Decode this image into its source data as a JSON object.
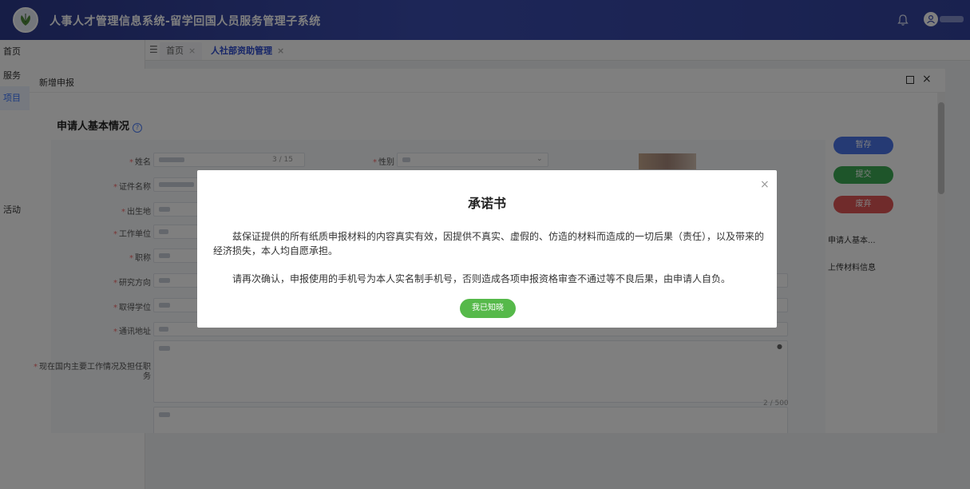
{
  "header": {
    "title": "人事人才管理信息系统-留学回国人员服务管理子系统"
  },
  "sidebar": {
    "items": [
      {
        "label": "首页"
      },
      {
        "label": "服务"
      },
      {
        "label": "项目"
      },
      {
        "label": "活动"
      }
    ]
  },
  "tabs": {
    "items": [
      {
        "label": "首页",
        "close": "×"
      },
      {
        "label": "人社部资助管理",
        "close": "×"
      }
    ]
  },
  "dialog": {
    "title": "新增申报",
    "close": "×",
    "section_title": "申请人基本情况",
    "help_glyph": "?",
    "fields": {
      "name": "姓名",
      "gender": "性别",
      "id_type": "证件名称",
      "birthplace": "出生地",
      "employer": "工作单位",
      "title": "职称",
      "research": "研究方向",
      "degree": "取得学位",
      "address": "通讯地址",
      "current_work": "现在国内主要工作情况及担任职务"
    },
    "name_counter": "3 / 15",
    "textarea_counter": "2 / 500",
    "required_mark": "*",
    "side_buttons": {
      "save": "暂存",
      "submit": "提交",
      "discard": "废弃"
    },
    "anchors": [
      "申请人基本...",
      "上传材料信息"
    ]
  },
  "modal": {
    "title": "承诺书",
    "close": "×",
    "paragraph1": "兹保证提供的所有纸质申报材料的内容真实有效，因提供不真实、虚假的、仿造的材料而造成的一切后果（责任），以及带来的经济损失，本人均自愿承担。",
    "paragraph2": "请再次确认，申报使用的手机号为本人实名制手机号，否则造成各项申报资格审查不通过等不良后果，由申请人自负。",
    "confirm_button": "我已知晓"
  },
  "colors": {
    "header_bg": "#3545a3",
    "primary": "#4a74e8",
    "success": "#56b94a",
    "danger": "#e05757",
    "overlay": "rgba(0,0,0,0.5)"
  }
}
